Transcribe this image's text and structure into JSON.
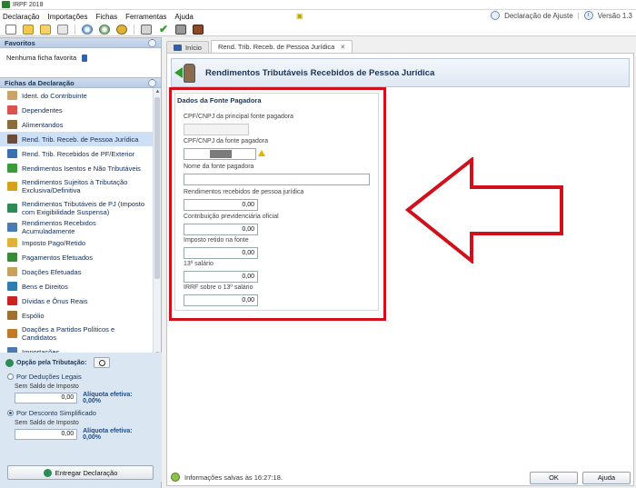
{
  "window": {
    "title": "IRPF 2018"
  },
  "menu": {
    "items": [
      "Declaração",
      "Importações",
      "Fichas",
      "Ferramentas",
      "Ajuda"
    ],
    "declaracao_ajuste": "Declaração de Ajuste",
    "versao": "Versão 1.3"
  },
  "toolbar": {
    "icons": [
      "new-document-icon",
      "open-icon",
      "folder-icon",
      "trash-icon",
      "globe-icon",
      "globe-download-icon",
      "coins-icon",
      "print-icon",
      "check-icon",
      "calculator-icon",
      "book-icon"
    ]
  },
  "sidebar": {
    "favoritos_title": "Favoritos",
    "favoritos_empty": "Nenhuma ficha favorita",
    "fichas_title": "Fichas da Declaração",
    "items": [
      {
        "label": "Ident. do Contribuinte",
        "color": "#c9a46a"
      },
      {
        "label": "Dependentes",
        "color": "#d9534f"
      },
      {
        "label": "Alimentandos",
        "color": "#8a6d3b"
      },
      {
        "label": "Rend. Trib. Receb. de Pessoa Jurídica",
        "color": "#6b4c3b"
      },
      {
        "label": "Rend. Trib. Recebidos de PF/Exterior",
        "color": "#3a6fb0"
      },
      {
        "label": "Rendimentos Isentos e Não Tributáveis",
        "color": "#3c9a3c"
      },
      {
        "label": "Rendimentos Sujeitos à Tributação Exclusiva/Definitiva",
        "color": "#d6a21e"
      },
      {
        "label": "Rendimentos Tributáveis de PJ (Imposto com Exigibilidade Suspensa)",
        "color": "#2e8b57"
      },
      {
        "label": "Rendimentos Recebidos Acumuladamente",
        "color": "#4a7ab0"
      },
      {
        "label": "Imposto Pago/Retido",
        "color": "#e0b23a"
      },
      {
        "label": "Pagamentos Efetuados",
        "color": "#3a8a3a"
      },
      {
        "label": "Doações Efetuadas",
        "color": "#c8a060"
      },
      {
        "label": "Bens e Direitos",
        "color": "#2e7db0"
      },
      {
        "label": "Dívidas e Ônus Reais",
        "color": "#cc2222"
      },
      {
        "label": "Espólio",
        "color": "#a07030"
      },
      {
        "label": "Doações a Partidos Políticos e Candidatos",
        "color": "#c07a2a"
      },
      {
        "label": "Importações",
        "color": "#4a7ab0"
      }
    ],
    "selected_index": 3
  },
  "opcao": {
    "title": "Opção pela Tributação:",
    "legais_label": "Por Deduções Legais",
    "legais_saldo_label": "Sem Saldo de Imposto",
    "legais_value": "0,00",
    "legais_aliquota": "Alíquota efetiva: 0,00%",
    "simplificado_label": "Por Desconto Simplificado",
    "simplificado_saldo_label": "Sem Saldo de Imposto",
    "simplificado_value": "0,00",
    "simplificado_aliquota": "Alíquota efetiva: 0,00%",
    "selected": "simplificado",
    "entregar_label": "Entregar Declaração"
  },
  "tabs": [
    {
      "label": "Início",
      "active": false
    },
    {
      "label": "Rend. Trib. Receb. de Pessoa Jurídica",
      "active": true
    }
  ],
  "form": {
    "page_title": "Rendimentos Tributáveis Recebidos de Pessoa Jurídica",
    "group_title": "Dados da Fonte Pagadora",
    "cpf_principal_label": "CPF/CNPJ da principal fonte pagadora",
    "cpf_principal_value": "",
    "cpf_fonte_label": "CPF/CNPJ da fonte pagadora",
    "nome_label": "Nome da fonte pagadora",
    "nome_value": "",
    "rendimentos_label": "Rendimentos recebidos de pessoa jurídica",
    "rendimentos_value": "0,00",
    "contribuicao_label": "Contribuição previdenciária oficial",
    "contribuicao_value": "0,00",
    "imposto_label": "Imposto retido na fonte",
    "imposto_value": "0,00",
    "decimo_label": "13º salário",
    "decimo_value": "0,00",
    "irrf_decimo_label": "IRRF sobre o 13º salário",
    "irrf_decimo_value": "0,00"
  },
  "status": {
    "text": "Informações salvas às 16:27:18.",
    "ok_label": "OK",
    "ajuda_label": "Ajuda"
  },
  "annotation": {
    "frame_color": "#d0101a"
  }
}
